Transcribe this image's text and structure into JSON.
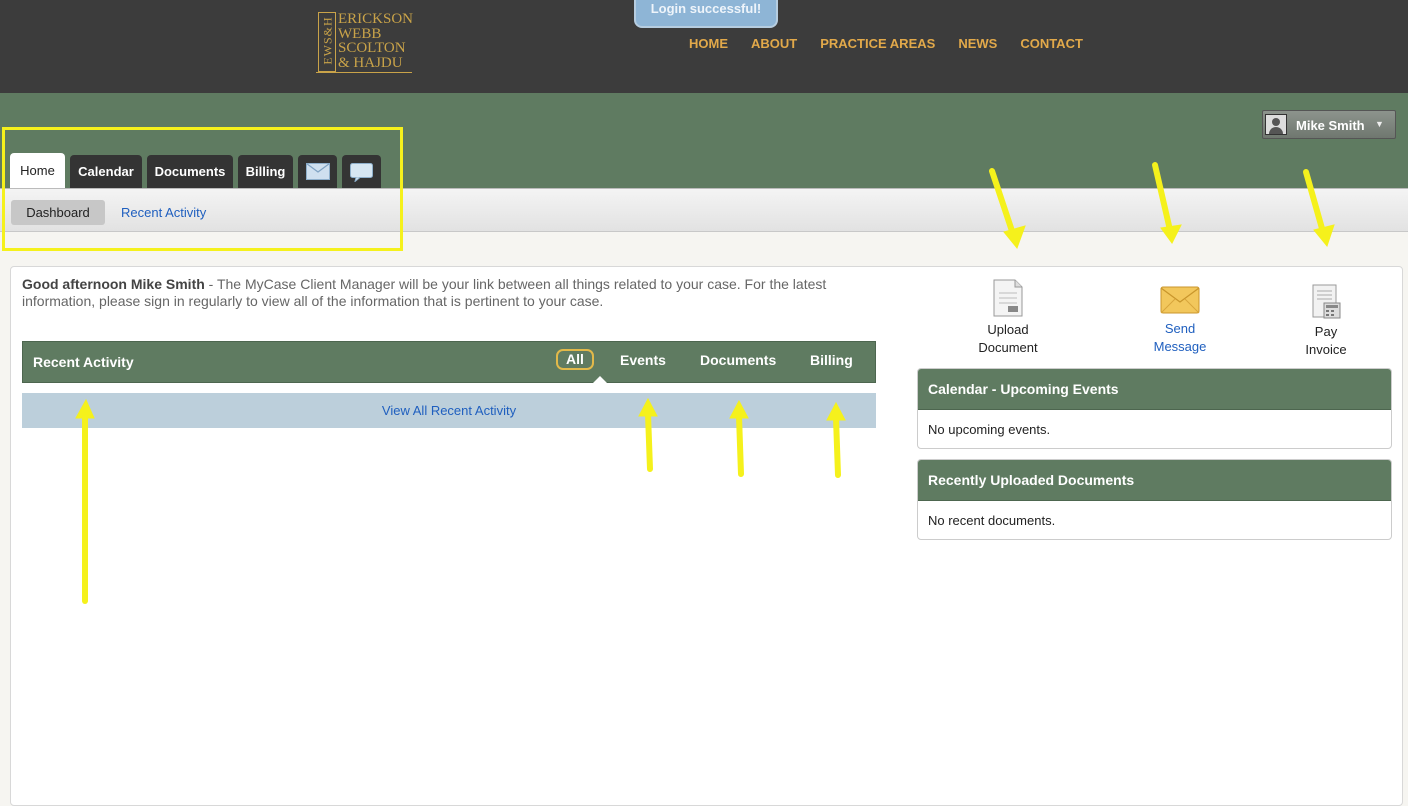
{
  "header": {
    "logo": {
      "monogram": "EWS&H",
      "lines": [
        "ERICKSON",
        "WEBB",
        "SCOLTON",
        "& HAJDU"
      ]
    },
    "toast": "Login successful!",
    "nav": [
      "HOME",
      "ABOUT",
      "PRACTICE AREAS",
      "NEWS",
      "CONTACT"
    ],
    "user": {
      "name": "Mike Smith"
    }
  },
  "tabs": [
    {
      "label": "Home",
      "active": true
    },
    {
      "label": "Calendar"
    },
    {
      "label": "Documents"
    },
    {
      "label": "Billing"
    },
    {
      "label": "",
      "icon": "mail-icon"
    },
    {
      "label": "",
      "icon": "chat-icon"
    }
  ],
  "subtabs": {
    "active": "Dashboard",
    "link": "Recent Activity"
  },
  "greeting": {
    "name": "Good afternoon Mike Smith",
    "message": " - The MyCase Client Manager will be your link between all things related to your case. For the latest information, please sign in regularly to view all of the information that is pertinent to your case."
  },
  "recent_activity": {
    "title": "Recent Activity",
    "filters": [
      "All",
      "Events",
      "Documents",
      "Billing"
    ],
    "active_filter": "All",
    "view_all": "View All Recent Activity"
  },
  "actions": [
    {
      "line1": "Upload",
      "line2": "Document",
      "icon": "document-icon"
    },
    {
      "line1": "Send",
      "line2": "Message",
      "icon": "envelope-icon"
    },
    {
      "line1": "Pay",
      "line2": "Invoice",
      "icon": "invoice-icon"
    }
  ],
  "panels": {
    "calendar": {
      "title": "Calendar - Upcoming Events",
      "body": "No upcoming events."
    },
    "documents": {
      "title": "Recently Uploaded Documents",
      "body": "No recent documents."
    }
  },
  "colors": {
    "accent_green": "#5f7b61",
    "nav_gold": "#e2a94a",
    "link_blue": "#1f5fbf",
    "highlight_yellow": "#f5f11c"
  }
}
